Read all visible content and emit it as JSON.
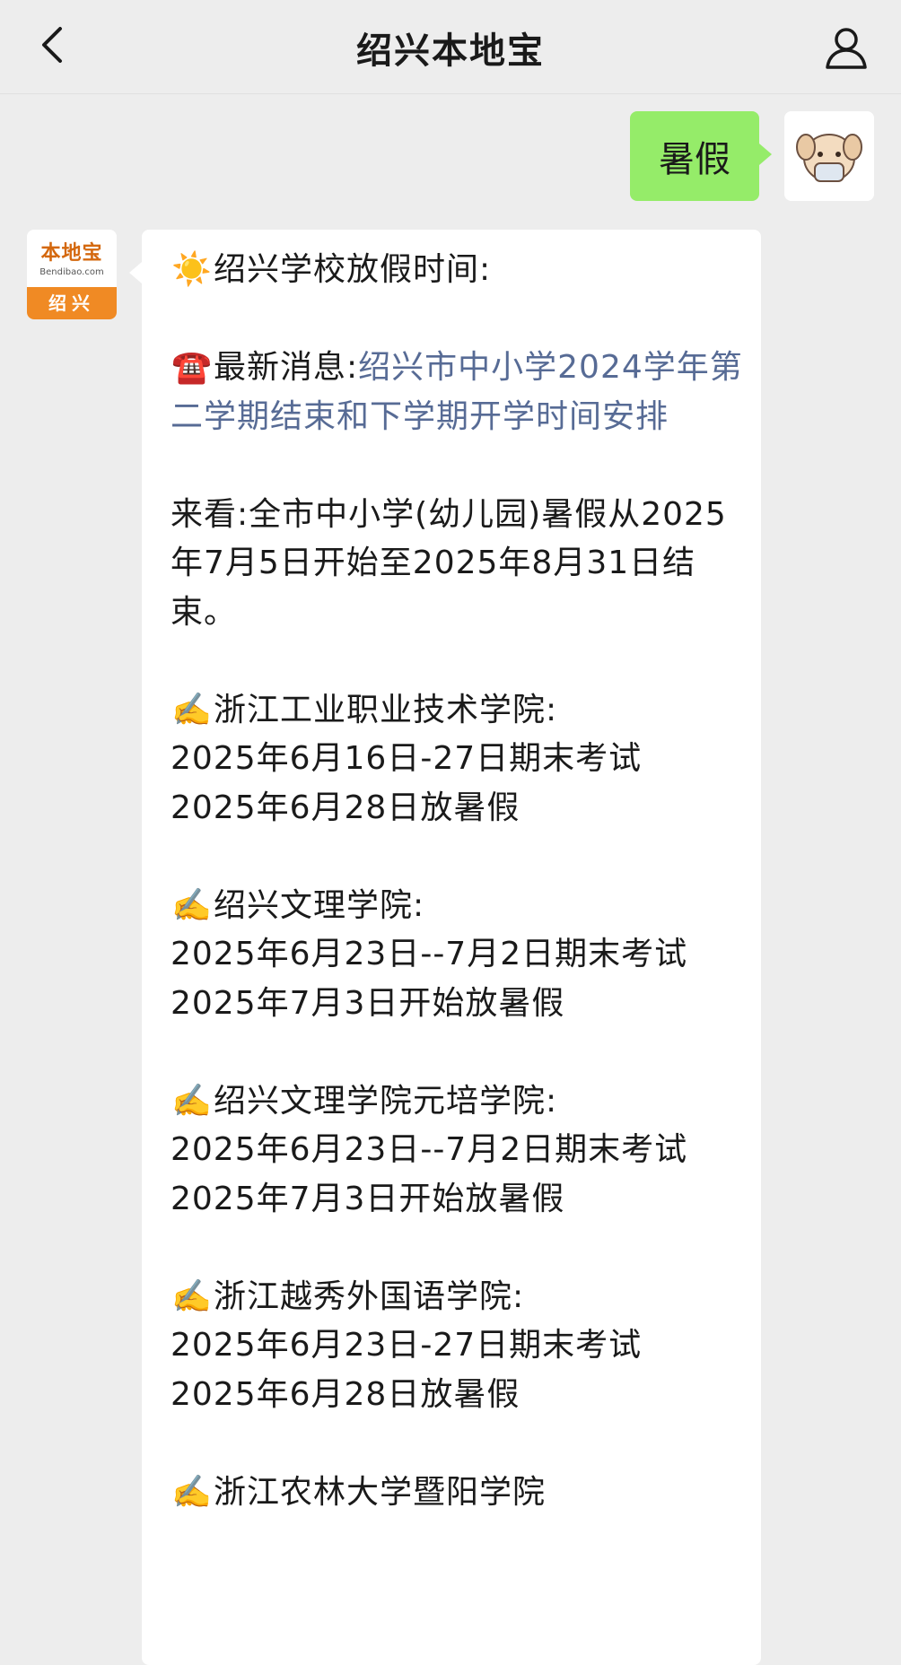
{
  "header": {
    "title": "绍兴本地宝",
    "back_icon": "chevron-left-icon",
    "profile_icon": "person-icon"
  },
  "outgoing": {
    "text": "暑假",
    "bubble_color": "#95ec69"
  },
  "bot": {
    "logo_main": "本地宝",
    "logo_sub": "Bendibao.com",
    "logo_city": "绍兴",
    "logo_color": "#f08a24"
  },
  "message": {
    "title_emoji": "☀️",
    "title": "绍兴学校放假时间:",
    "news_emoji": "☎️",
    "news_label": "最新消息:",
    "news_link": "绍兴市中小学2024学年第二学期结束和下学期开学时间安排",
    "lookup": "来看:全市中小学(幼儿园)暑假从2025年7月5日开始至2025年8月31日结束。",
    "entries": [
      {
        "emoji": "✍️",
        "school": "浙江工业职业技术学院:",
        "lines": [
          "2025年6月16日-27日期末考试",
          "2025年6月28日放暑假"
        ]
      },
      {
        "emoji": "✍️",
        "school": "绍兴文理学院:",
        "lines": [
          "2025年6月23日--7月2日期末考试",
          "2025年7月3日开始放暑假"
        ]
      },
      {
        "emoji": "✍️",
        "school": "绍兴文理学院元培学院:",
        "lines": [
          "2025年6月23日--7月2日期末考试",
          "2025年7月3日开始放暑假"
        ]
      },
      {
        "emoji": "✍️",
        "school": "浙江越秀外国语学院:",
        "lines": [
          "2025年6月23日-27日期末考试",
          "2025年6月28日放暑假"
        ]
      },
      {
        "emoji": "✍️",
        "school": "浙江农林大学暨阳学院",
        "lines": []
      }
    ],
    "link_color": "#576b95"
  }
}
